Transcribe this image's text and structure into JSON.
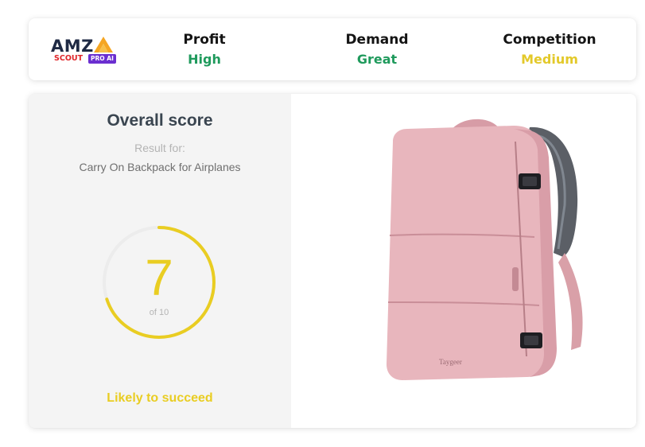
{
  "brand": {
    "name": "AMZ",
    "sub": "SCOUT",
    "badge": "PRO AI"
  },
  "metrics": [
    {
      "label": "Profit",
      "value": "High",
      "color": "#1f9a5c"
    },
    {
      "label": "Demand",
      "value": "Great",
      "color": "#1f9a5c"
    },
    {
      "label": "Competition",
      "value": "Medium",
      "color": "#e3c92a"
    }
  ],
  "score": {
    "title": "Overall score",
    "result_label": "Result for:",
    "product": "Carry On Backpack for Airplanes",
    "value": "7",
    "of_label": "of 10",
    "fraction": 0.7,
    "verdict": "Likely to succeed",
    "accent": "#e9cd22"
  },
  "product_image": {
    "icon": "pink-backpack-image",
    "brand_print": "Taygeer",
    "color": "#e8b6bd"
  }
}
